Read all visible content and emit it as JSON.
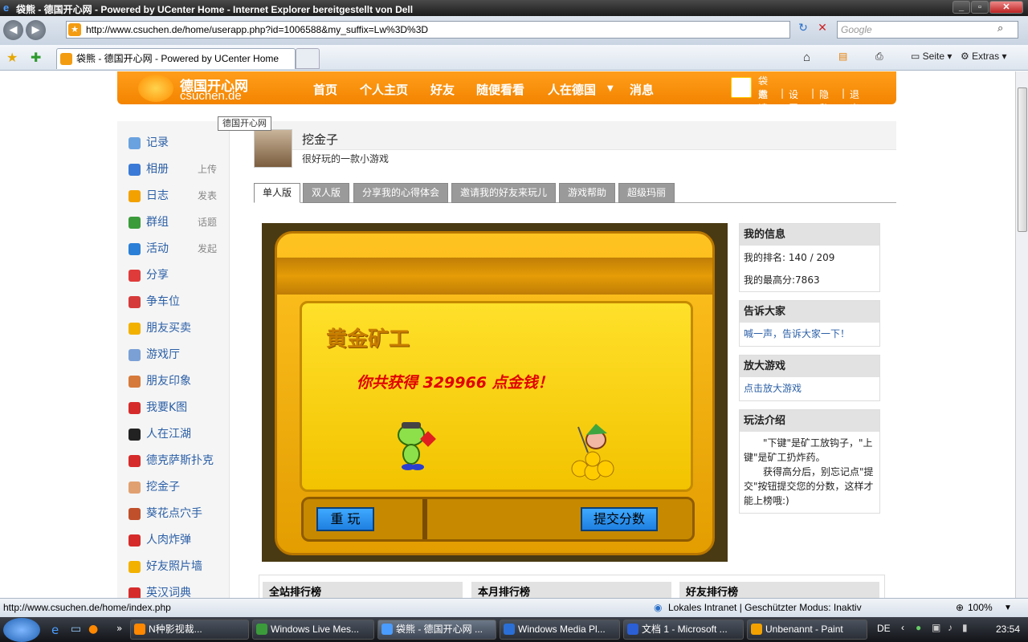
{
  "window": {
    "title": "袋熊 - 德国开心网 - Powered by UCenter Home - Internet Explorer bereitgestellt von Dell"
  },
  "browser": {
    "url": "http://www.csuchen.de/home/userapp.php?id=1006588&my_suffix=Lw%3D%3D",
    "search_placeholder": "Google",
    "tab_title": "袋熊 - 德国开心网 - Powered by UCenter Home",
    "page_menu": "Seite",
    "tools_menu": "Extras"
  },
  "site": {
    "logo_cn": "德国开心网",
    "logo_en": "csuchen.de",
    "tooltip": "德国开心网",
    "nav": [
      "首页",
      "个人主页",
      "好友",
      "随便看看",
      "人在德国",
      "消息"
    ],
    "user": {
      "name": "袋熊",
      "links": [
        "邀请",
        "设置",
        "隐私",
        "退出"
      ]
    }
  },
  "sidebar": [
    {
      "label": "记录",
      "extra": "",
      "icon": "speech-bubble-icon"
    },
    {
      "label": "相册",
      "extra": "上传",
      "icon": "photo-icon"
    },
    {
      "label": "日志",
      "extra": "发表",
      "icon": "notebook-icon"
    },
    {
      "label": "群组",
      "extra": "话题",
      "icon": "group-icon"
    },
    {
      "label": "活动",
      "extra": "发起",
      "icon": "event-icon"
    },
    {
      "label": "分享",
      "extra": "",
      "icon": "heart-icon"
    },
    {
      "label": "争车位",
      "extra": "",
      "icon": "car-icon"
    },
    {
      "label": "朋友买卖",
      "extra": "",
      "icon": "coins-icon"
    },
    {
      "label": "游戏厅",
      "extra": "",
      "icon": "gamepad-icon"
    },
    {
      "label": "朋友印象",
      "extra": "",
      "icon": "person-icon"
    },
    {
      "label": "我要K图",
      "extra": "",
      "icon": "k-icon"
    },
    {
      "label": "人在江湖",
      "extra": "",
      "icon": "warrior-icon"
    },
    {
      "label": "德克萨斯扑克",
      "extra": "",
      "icon": "poker-chip-icon"
    },
    {
      "label": "挖金子",
      "extra": "",
      "icon": "miner-icon"
    },
    {
      "label": "葵花点穴手",
      "extra": "",
      "icon": "hand-icon"
    },
    {
      "label": "人肉炸弹",
      "extra": "",
      "icon": "bomb-icon"
    },
    {
      "label": "好友照片墙",
      "extra": "",
      "icon": "smiley-icon"
    },
    {
      "label": "英汉词典",
      "extra": "",
      "icon": "dictionary-icon"
    }
  ],
  "app": {
    "title": "挖金子",
    "desc": "很好玩的一款小游戏",
    "tabs": [
      "单人版",
      "双人版",
      "分享我的心得体会",
      "邀请我的好友来玩儿",
      "游戏帮助",
      "超级玛丽"
    ]
  },
  "game": {
    "title": "黄金矿工",
    "score_text": "你共获得  329966  点金钱！",
    "replay": "重 玩",
    "submit": "提交分数"
  },
  "panels": {
    "myinfo": {
      "title": "我的信息",
      "rank_label": "我的排名:",
      "rank": "140 / 209",
      "best_label": "我的最高分:",
      "best": "7863"
    },
    "tell": {
      "title": "告诉大家",
      "link": "喊一声，告诉大家一下！"
    },
    "zoom": {
      "title": "放大游戏",
      "link": "点击放大游戏"
    },
    "howto": {
      "title": "玩法介绍",
      "text1": "\"下键\"是矿工放钩子，\"上键\"是矿工扔炸药。",
      "text2": "获得高分后，别忘记点\"提交\"按钮提交您的分数，这样才能上榜哦:)"
    }
  },
  "rankings": [
    "全站排行榜",
    "本月排行榜",
    "好友排行榜"
  ],
  "status": {
    "url": "http://www.csuchen.de/home/index.php",
    "zone": "Lokales Intranet | Geschützter Modus: Inaktiv",
    "zoom": "100%"
  },
  "taskbar": {
    "items": [
      "N种影视裁...",
      "Windows Live Mes...",
      "袋熊 - 德国开心网 ...",
      "Windows Media Pl...",
      "文档 1 - Microsoft ...",
      "Unbenannt - Paint"
    ],
    "lang": "DE",
    "time": "23:54"
  }
}
